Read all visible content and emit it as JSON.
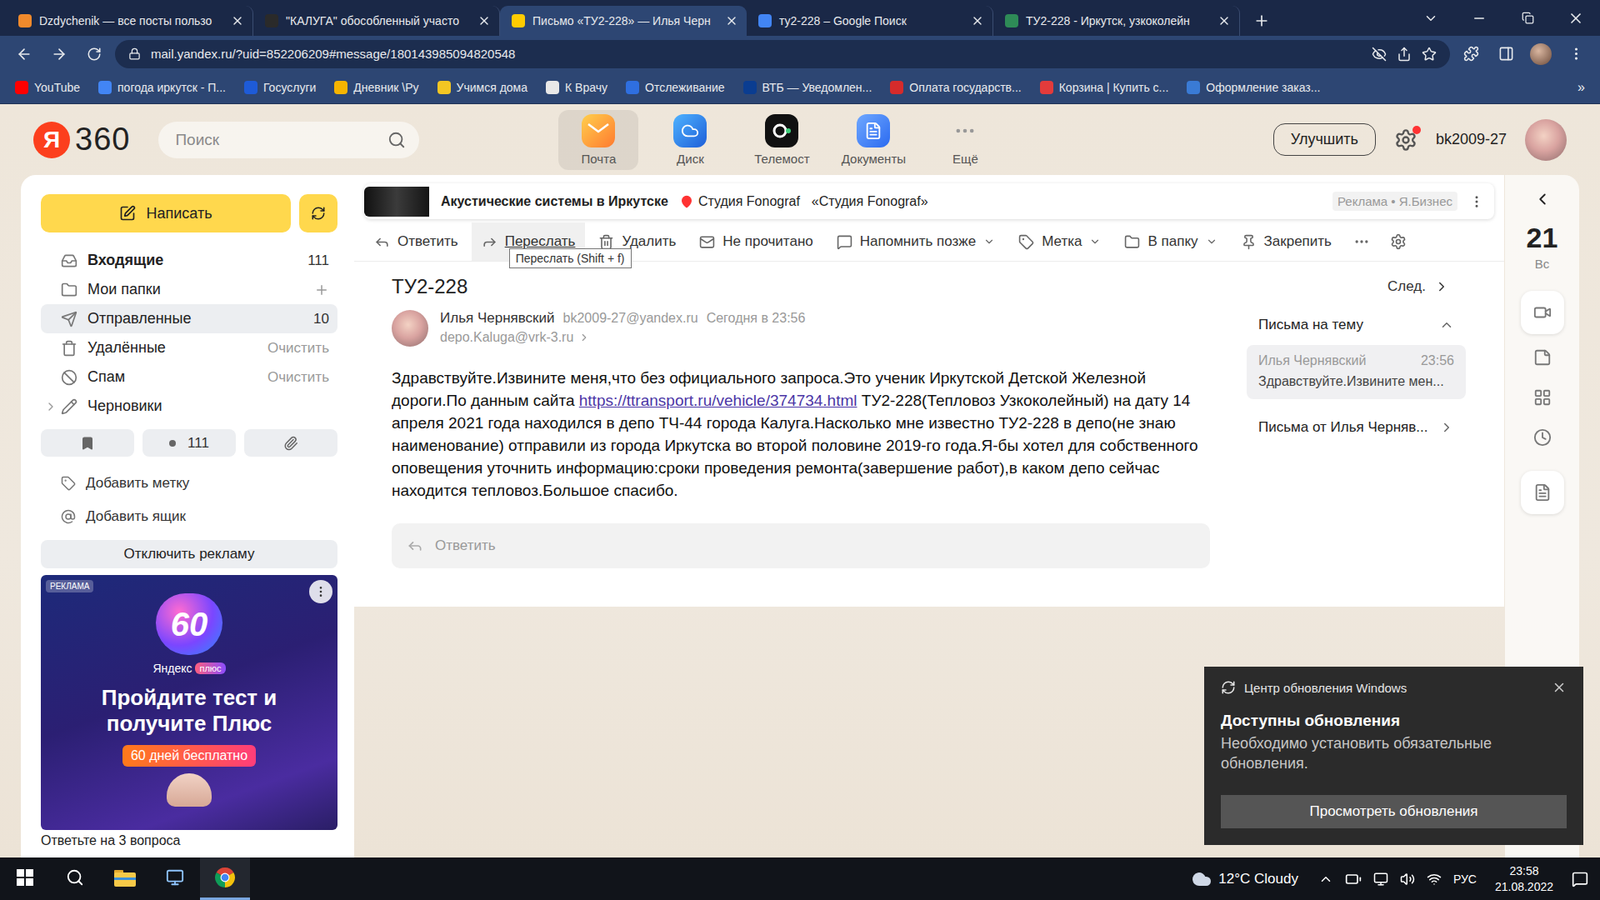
{
  "browser": {
    "tabs": [
      {
        "label": "Dzdychenik — все посты пользо",
        "selected": false
      },
      {
        "label": "\"КАЛУГА\" обособленный участо",
        "selected": false
      },
      {
        "label": "Письмо «ТУ2-228» — Илья Черн",
        "selected": true
      },
      {
        "label": "ту2-228 – Google Поиск",
        "selected": false
      },
      {
        "label": "ТУ2-228 - Иркутск, узкоколейн",
        "selected": false
      }
    ],
    "address": "mail.yandex.ru/?uid=852206209#message/180143985094820548",
    "bookmarks": [
      "YouTube",
      "погода иркутск - П...",
      "Госуслуги",
      "Дневник \\Ру",
      "Учимся дома",
      "К Врачу",
      "Отслеживание",
      "ВТБ — Уведомлен...",
      "Оплата государств...",
      "Корзина | Купить с...",
      "Оформление заказ..."
    ],
    "bookmarks_more": "»"
  },
  "header": {
    "logo_letter": "Я",
    "logo_text": "360",
    "search_placeholder": "Поиск",
    "services": [
      {
        "label": "Почта",
        "selected": true
      },
      {
        "label": "Диск",
        "selected": false
      },
      {
        "label": "Телемост",
        "selected": false
      },
      {
        "label": "Документы",
        "selected": false
      },
      {
        "label": "Ещё",
        "selected": false
      }
    ],
    "upgrade": "Улучшить",
    "settings_badge": true,
    "user": "bk2009-27"
  },
  "sidebar": {
    "compose": "Написать",
    "folders": [
      {
        "label": "Входящие",
        "kind": "count",
        "trailing": "111",
        "unread": true,
        "selected": false,
        "expandable": false,
        "expanded": false
      },
      {
        "label": "Мои папки",
        "kind": "add",
        "trailing": "",
        "unread": false,
        "selected": false,
        "expandable": false,
        "expanded": false
      },
      {
        "label": "Отправленные",
        "kind": "count",
        "trailing": "10",
        "unread": false,
        "selected": true,
        "expandable": false,
        "expanded": false
      },
      {
        "label": "Удалённые",
        "kind": "action",
        "trailing": "Очистить",
        "unread": false,
        "selected": false,
        "expandable": false,
        "expanded": false
      },
      {
        "label": "Спам",
        "kind": "action",
        "trailing": "Очистить",
        "unread": false,
        "selected": false,
        "expandable": false,
        "expanded": false
      },
      {
        "label": "Черновики",
        "kind": "none",
        "trailing": "",
        "unread": false,
        "selected": false,
        "expandable": true,
        "expanded": false
      }
    ],
    "unread_filter_count": "111",
    "add_label": "Добавить метку",
    "add_mailbox": "Добавить ящик",
    "disable_ads": "Отключить рекламу",
    "ad": {
      "badge": "РЕКЛАМА",
      "number": "60",
      "brand": "Яндекс",
      "brand_tag": "плюс",
      "headline": "Пройдите тест и получите Плюс",
      "offer": "60 дней бесплатно"
    },
    "below_ad": "Ответьте на 3 вопроса"
  },
  "ad_bar": {
    "title": "Акустические системы в Иркутске",
    "place": "Студия Fonograf",
    "company": "«Студия Fonograf»",
    "label": "Реклама • Я.Бизнес"
  },
  "toolbar": {
    "actions": [
      {
        "label": "Ответить",
        "dropdown": false,
        "hovered": false
      },
      {
        "label": "Переслать",
        "dropdown": false,
        "hovered": true
      },
      {
        "label": "Удалить",
        "dropdown": false,
        "hovered": false
      },
      {
        "label": "Не прочитано",
        "dropdown": false,
        "hovered": false
      },
      {
        "label": "Напомнить позже",
        "dropdown": true,
        "hovered": false
      },
      {
        "label": "Метка",
        "dropdown": true,
        "hovered": false
      },
      {
        "label": "В папку",
        "dropdown": true,
        "hovered": false
      },
      {
        "label": "Закрепить",
        "dropdown": false,
        "hovered": false
      }
    ],
    "tooltip": "Переслать (Shift + f)"
  },
  "message": {
    "subject": "ТУ2-228",
    "next": "След.",
    "sender": "Илья Чернявский",
    "sender_email": "bk2009-27@yandex.ru",
    "date": "Сегодня в 23:56",
    "recipient": "depo.Kaluga@vrk-3.ru",
    "body_before": "Здравствуйте.Извините меня,что без официального запроса.Это ученик Иркутской Детской Железной дороги.По данным сайта ",
    "link": "https://ttransport.ru/vehicle/374734.html",
    "body_after": " ТУ2-228(Тепловоз Узкоколейный) на дату 14 апреля 2021 года находился в депо ТЧ-44 города Калуга.Насколько мне известно ТУ2-228 в депо(не знаю наименование) отправили из города Иркутска во второй половине 2019-го года.Я-бы хотел для собственного оповещения уточнить информацию:сроки проведения ремонта(завершение работ),в каком депо сейчас находится тепловоз.Большое спасибо.",
    "reply_placeholder": "Ответить"
  },
  "thread": {
    "title": "Письма на тему",
    "expanded": true,
    "items": [
      {
        "sender": "Илья Чернявский",
        "time": "23:56",
        "preview": "Здравствуйте.Извините мен...",
        "selected": true
      }
    ],
    "from_sender": "Письма от Илья Черняв..."
  },
  "rail": {
    "day": "21",
    "weekday": "Вс"
  },
  "notification": {
    "app": "Центр обновления Windows",
    "title": "Доступны обновления",
    "text": "Необходимо установить обязательные обновления.",
    "button": "Просмотреть обновления"
  },
  "taskbar": {
    "weather": "12°C Cloudy",
    "language": "РУС",
    "time": "23:58",
    "date": "21.08.2022"
  }
}
